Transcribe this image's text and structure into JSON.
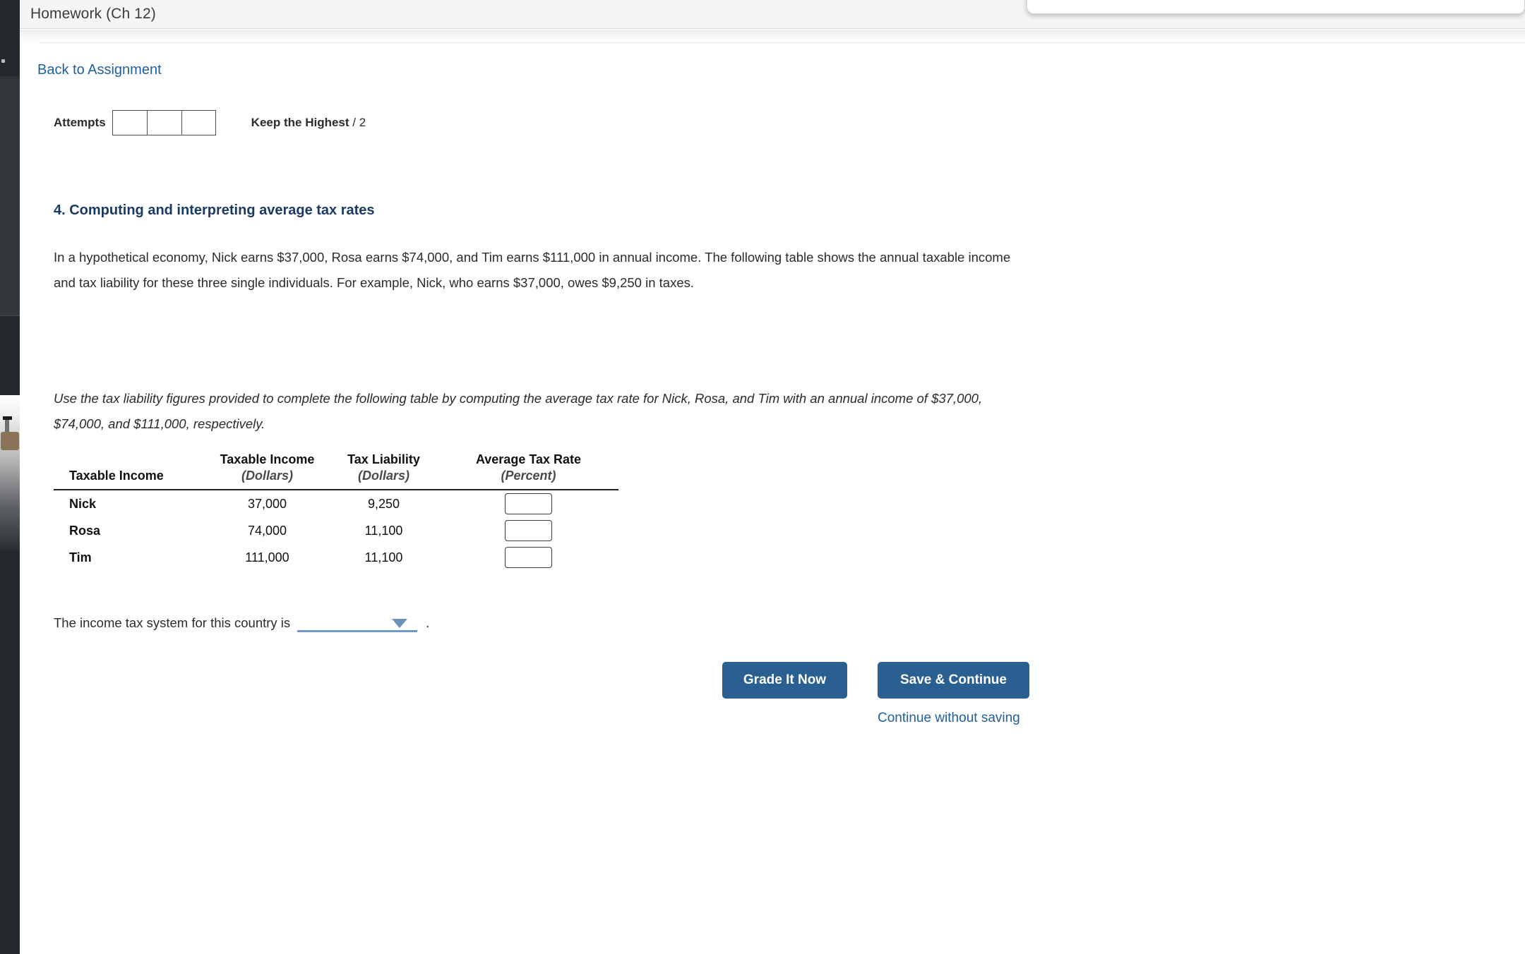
{
  "window": {
    "title": "Homework (Ch 12)"
  },
  "nav": {
    "back_link": "Back to Assignment"
  },
  "attempts": {
    "label": "Attempts",
    "boxes": [
      "",
      "",
      ""
    ],
    "keep_highest_label": "Keep the Highest",
    "keep_highest_separator": "/",
    "keep_highest_value": "2"
  },
  "question": {
    "heading": "4. Computing and interpreting average tax rates",
    "intro": "In a hypothetical economy, Nick earns $37,000, Rosa earns $74,000, and Tim earns $111,000 in annual income. The following table shows the annual taxable income and tax liability for these three single individuals. For example, Nick, who earns $37,000, owes $9,250 in taxes.",
    "instruction": "Use the tax liability figures provided to complete the following table by computing the average tax rate for Nick, Rosa, and Tim with an annual income of $37,000, $74,000, and $111,000, respectively."
  },
  "table": {
    "headers_top": [
      "",
      "Taxable Income",
      "Tax Liability",
      "Average Tax Rate"
    ],
    "headers_sub": [
      "Taxable Income",
      "(Dollars)",
      "(Dollars)",
      "(Percent)"
    ],
    "rows": [
      {
        "name": "Nick",
        "taxable_income": "37,000",
        "tax_liability": "9,250",
        "average_tax_rate": ""
      },
      {
        "name": "Rosa",
        "taxable_income": "74,000",
        "tax_liability": "11,100",
        "average_tax_rate": ""
      },
      {
        "name": "Tim",
        "taxable_income": "111,000",
        "tax_liability": "11,100",
        "average_tax_rate": ""
      }
    ]
  },
  "system_question": {
    "lead_text": "The income tax system for this country is",
    "dropdown_value": "",
    "period": "."
  },
  "actions": {
    "grade_label": "Grade It Now",
    "save_label": "Save & Continue",
    "continue_label": "Continue without saving"
  },
  "colors": {
    "accent_blue": "#2a5f91",
    "link_blue": "#1f5f9e",
    "heading_navy": "#1b3a63",
    "dropdown_blue": "#6f9ac6",
    "rail_dark": "#25282c"
  }
}
